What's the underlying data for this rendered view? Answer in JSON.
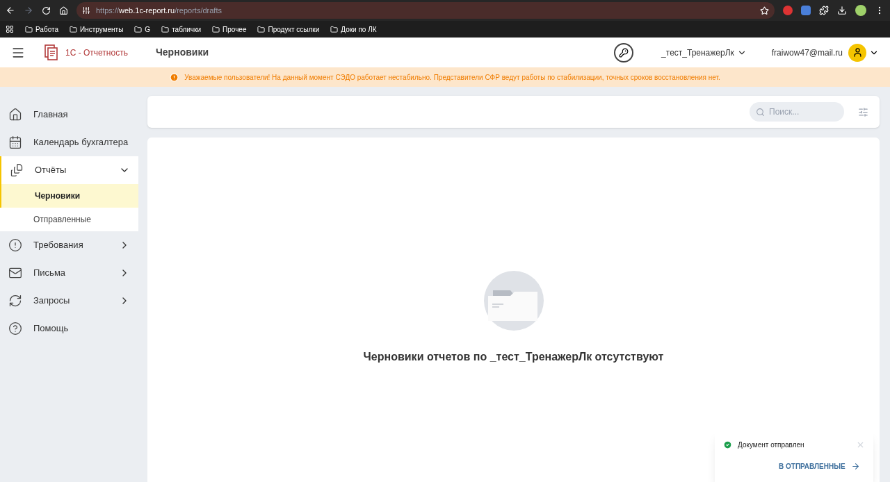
{
  "browser": {
    "url_host": "web.1c-report.ru",
    "url_scheme": "https://",
    "url_path": "/reports/drafts",
    "bookmarks": [
      "Работа",
      "Инструменты",
      "G",
      "таблички",
      "Прочее",
      "Продукт ссылки",
      "Доки по ЛК"
    ]
  },
  "header": {
    "brand": "1С - Отчетность",
    "page_title": "Черновики",
    "organization": "_тест_ТренажерЛк",
    "user": "fraiwow47@mail.ru"
  },
  "banner": "Уважаемые пользователи! На данный момент СЭДО работает нестабильно. Представители СФР ведут работы по стабилизации, точных сроков восстановления нет.",
  "sidebar": {
    "items": [
      {
        "label": "Главная",
        "kind": "home"
      },
      {
        "label": "Календарь бухгалтера",
        "kind": "calendar"
      },
      {
        "label": "Отчёты",
        "kind": "reports",
        "expanded": true,
        "children": [
          {
            "label": "Черновики",
            "selected": true
          },
          {
            "label": "Отправленные",
            "selected": false
          }
        ]
      },
      {
        "label": "Требования",
        "kind": "alert",
        "expanded": false
      },
      {
        "label": "Письма",
        "kind": "mail",
        "expanded": false
      },
      {
        "label": "Запросы",
        "kind": "refresh",
        "expanded": false
      },
      {
        "label": "Помощь",
        "kind": "help"
      }
    ]
  },
  "search": {
    "placeholder": "Поиск..."
  },
  "empty_message": "Черновики отчетов по _тест_ТренажерЛк отсутствуют",
  "toast": {
    "message": "Документ отправлен",
    "action": "В ОТПРАВЛЕННЫЕ"
  }
}
